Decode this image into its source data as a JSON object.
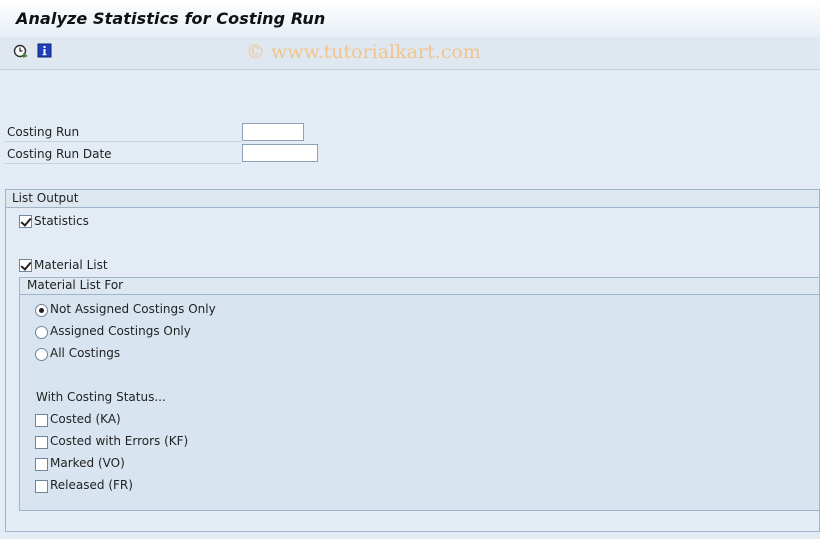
{
  "window": {
    "title": "Analyze Statistics for Costing Run"
  },
  "toolbar": {
    "execute_icon": "execute-clock-icon",
    "info_icon": "info-icon",
    "watermark": "© www.tutorialkart.com"
  },
  "fields": {
    "costing_run_label": "Costing Run",
    "costing_run_value": "",
    "costing_run_date_label": "Costing Run Date",
    "costing_run_date_value": ""
  },
  "list_output": {
    "title": "List Output",
    "statistics_label": "Statistics",
    "statistics_checked": true,
    "material_list_label": "Material List",
    "material_list_checked": true
  },
  "material_list_for": {
    "title": "Material List For",
    "options": [
      {
        "label": "Not Assigned Costings Only",
        "selected": true
      },
      {
        "label": "Assigned Costings Only",
        "selected": false
      },
      {
        "label": "All Costings",
        "selected": false
      }
    ],
    "status_heading": "With Costing Status...",
    "statuses": [
      {
        "label": "Costed (KA)",
        "checked": false
      },
      {
        "label": "Costed with Errors (KF)",
        "checked": false
      },
      {
        "label": "Marked (VO)",
        "checked": false
      },
      {
        "label": "Released (FR)",
        "checked": false
      }
    ]
  },
  "colors": {
    "background": "#e3ecf4",
    "watermark": "#f2c48d",
    "info_icon": "#1f3fbf"
  }
}
